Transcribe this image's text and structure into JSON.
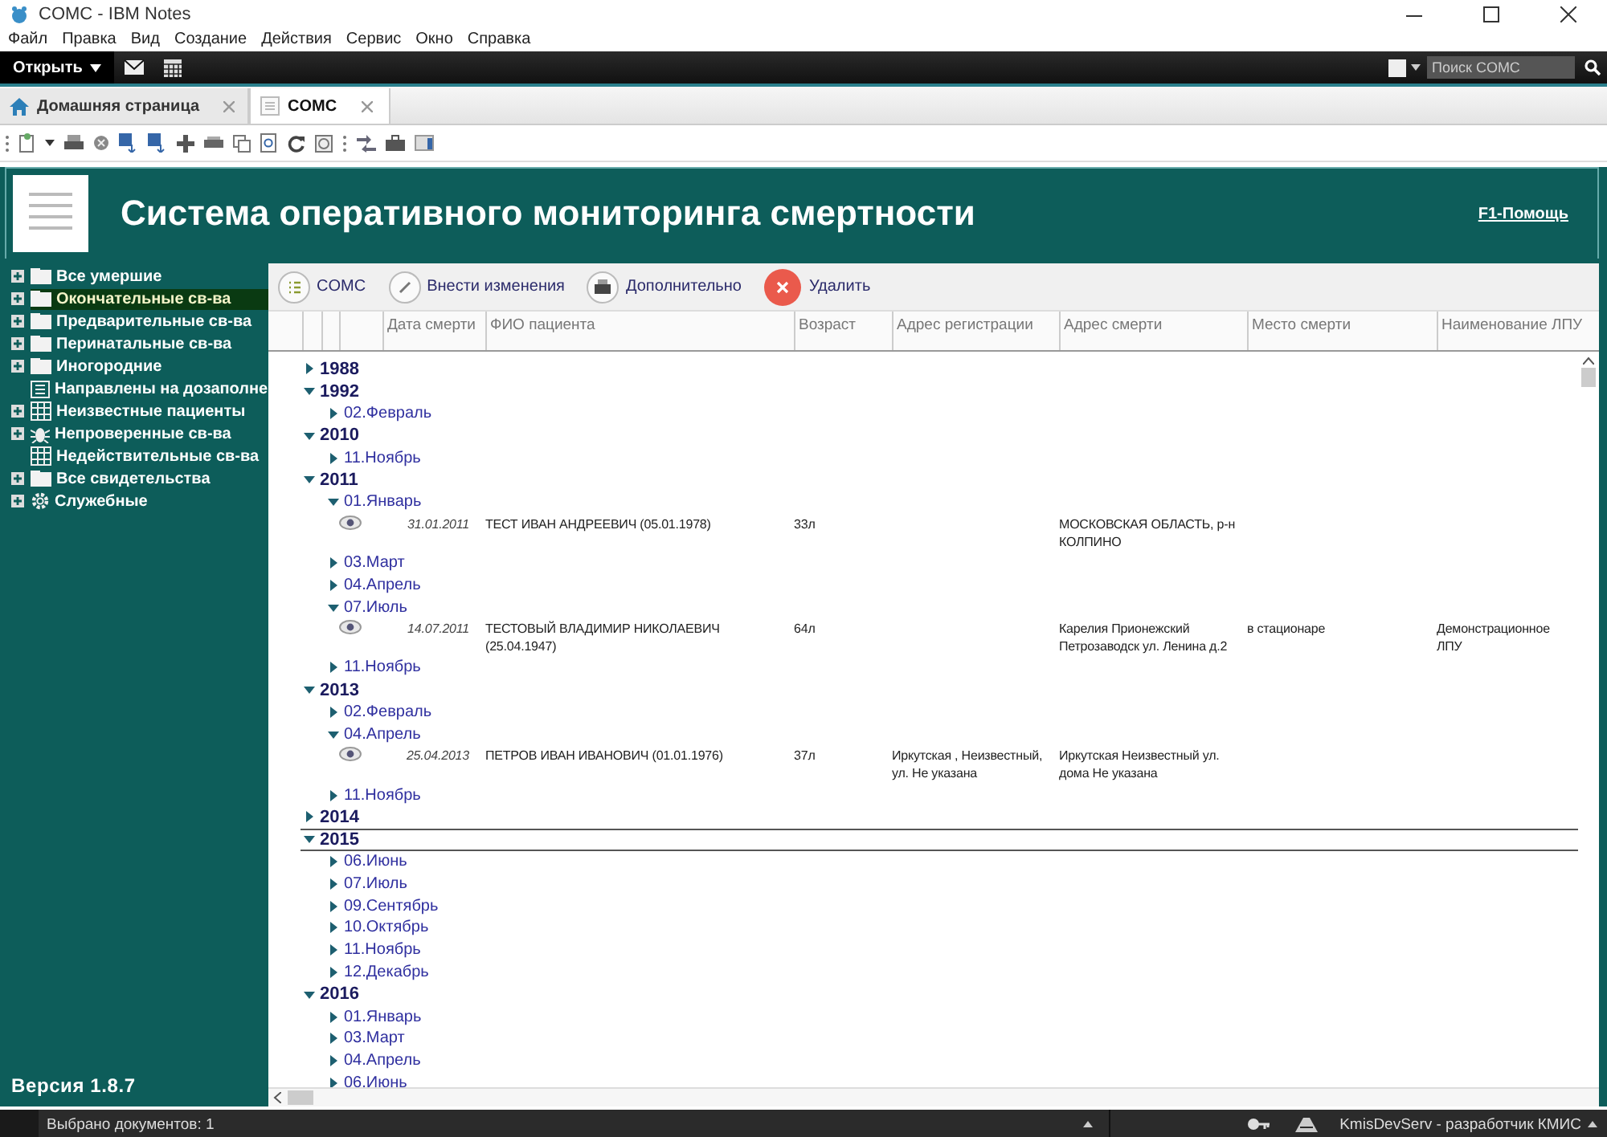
{
  "window": {
    "title": "COMC - IBM Notes"
  },
  "menu": [
    "Файл",
    "Правка",
    "Вид",
    "Создание",
    "Действия",
    "Сервис",
    "Окно",
    "Справка"
  ],
  "top_bar": {
    "open_button": "Открыть",
    "search": {
      "placeholder": "Поиск COMC"
    }
  },
  "tabs": [
    {
      "label": "Домашняя страница",
      "kind": "home",
      "selected": false
    },
    {
      "label": "COMC",
      "kind": "doc",
      "selected": true
    }
  ],
  "app_header": {
    "title": "Система оперативного мониторинга смертности",
    "help_link": "F1-Помощь"
  },
  "sidebar": {
    "items": [
      {
        "label": "Все умершие",
        "kind": "folder",
        "expandable": true,
        "selected": false
      },
      {
        "label": "Окончательные св-ва",
        "kind": "folder",
        "expandable": true,
        "selected": true
      },
      {
        "label": "Предварительные св-ва",
        "kind": "folder",
        "expandable": true,
        "selected": false
      },
      {
        "label": "Перинатальные св-ва",
        "kind": "folder",
        "expandable": true,
        "selected": false
      },
      {
        "label": "Иногородние",
        "kind": "folder",
        "expandable": true,
        "selected": false
      },
      {
        "label": "Направлены на дозаполне",
        "kind": "calendar",
        "expandable": false,
        "selected": false
      },
      {
        "label": "Неизвестные пациенты",
        "kind": "grid",
        "expandable": true,
        "selected": false
      },
      {
        "label": "Непроверенные св-ва",
        "kind": "bug",
        "expandable": true,
        "selected": false
      },
      {
        "label": "Недействительные св-ва",
        "kind": "grid",
        "expandable": false,
        "selected": false
      },
      {
        "label": "Все свидетельства",
        "kind": "folder",
        "expandable": true,
        "selected": false
      },
      {
        "label": "Служебные",
        "kind": "gear",
        "expandable": true,
        "selected": false
      }
    ],
    "version": "Версия 1.8.7"
  },
  "actions": [
    {
      "label": "COMC",
      "kind": "list"
    },
    {
      "label": "Внести изменения",
      "kind": "edit"
    },
    {
      "label": "Дополнительно",
      "kind": "print"
    },
    {
      "label": "Удалить",
      "kind": "delete"
    }
  ],
  "table": {
    "columns": [
      "Дата смерти",
      "ФИО пациента",
      "Возраст",
      "Адрес регистрации",
      "Адрес смерти",
      "Место смерти",
      "Наименование ЛПУ"
    ],
    "rows": [
      {
        "label": "1988",
        "expanded": false,
        "selected": false
      },
      {
        "label": "1992",
        "expanded": true,
        "selected": false,
        "children": [
          {
            "label": "02.Февраль",
            "expanded": false
          }
        ]
      },
      {
        "label": "2010",
        "expanded": true,
        "selected": false,
        "children": [
          {
            "label": "11.Ноябрь",
            "expanded": false
          }
        ]
      },
      {
        "label": "2011",
        "expanded": true,
        "selected": false,
        "children": [
          {
            "label": "01.Январь",
            "expanded": true,
            "documents": [
              {
                "date": "31.01.2011",
                "patient": "ТЕСТ ИВАН АНДРЕЕВИЧ (05.01.1978)",
                "age": "33л",
                "death_address": "МОСКОВСКАЯ ОБЛАСТЬ, р-н КОЛПИНО"
              }
            ]
          },
          {
            "label": "03.Март",
            "expanded": false
          },
          {
            "label": "04.Апрель",
            "expanded": false
          },
          {
            "label": "07.Июль",
            "expanded": true,
            "documents": [
              {
                "date": "14.07.2011",
                "patient": "ТЕСТОВЫЙ ВЛАДИМИР НИКОЛАЕВИЧ (25.04.1947)",
                "age": "64л",
                "death_address": "Карелия Прионежский Петрозаводск ул. Ленина д.2",
                "death_place": "в стационаре",
                "facility": "Демонстрационное ЛПУ"
              }
            ]
          },
          {
            "label": "11.Ноябрь",
            "expanded": false
          }
        ]
      },
      {
        "label": "2013",
        "expanded": true,
        "selected": false,
        "children": [
          {
            "label": "02.Февраль",
            "expanded": false
          },
          {
            "label": "04.Апрель",
            "expanded": true,
            "documents": [
              {
                "date": "25.04.2013",
                "patient": "ПЕТРОВ ИВАН ИВАНОВИЧ (01.01.1976)",
                "age": "37л",
                "registration_address": "Иркутская , Неизвестный, ул. Не указана",
                "death_address": "Иркутская Неизвестный ул. дома Не указана"
              }
            ]
          },
          {
            "label": "11.Ноябрь",
            "expanded": false
          }
        ]
      },
      {
        "label": "2014",
        "expanded": false,
        "selected": false
      },
      {
        "label": "2015",
        "expanded": true,
        "selected": true,
        "children": [
          {
            "label": "06.Июнь",
            "expanded": false
          },
          {
            "label": "07.Июль",
            "expanded": false
          },
          {
            "label": "09.Сентябрь",
            "expanded": false
          },
          {
            "label": "10.Октябрь",
            "expanded": false
          },
          {
            "label": "11.Ноябрь",
            "expanded": false
          },
          {
            "label": "12.Декабрь",
            "expanded": false
          }
        ]
      },
      {
        "label": "2016",
        "expanded": true,
        "selected": false,
        "children": [
          {
            "label": "01.Январь",
            "expanded": false
          },
          {
            "label": "03.Март",
            "expanded": false
          },
          {
            "label": "04.Апрель",
            "expanded": false
          },
          {
            "label": "06.Июнь",
            "expanded": false
          }
        ]
      }
    ]
  },
  "status_bar": {
    "text": "Выбрано документов: 1",
    "server": "KmisDevServ - разработчик КМИС"
  }
}
